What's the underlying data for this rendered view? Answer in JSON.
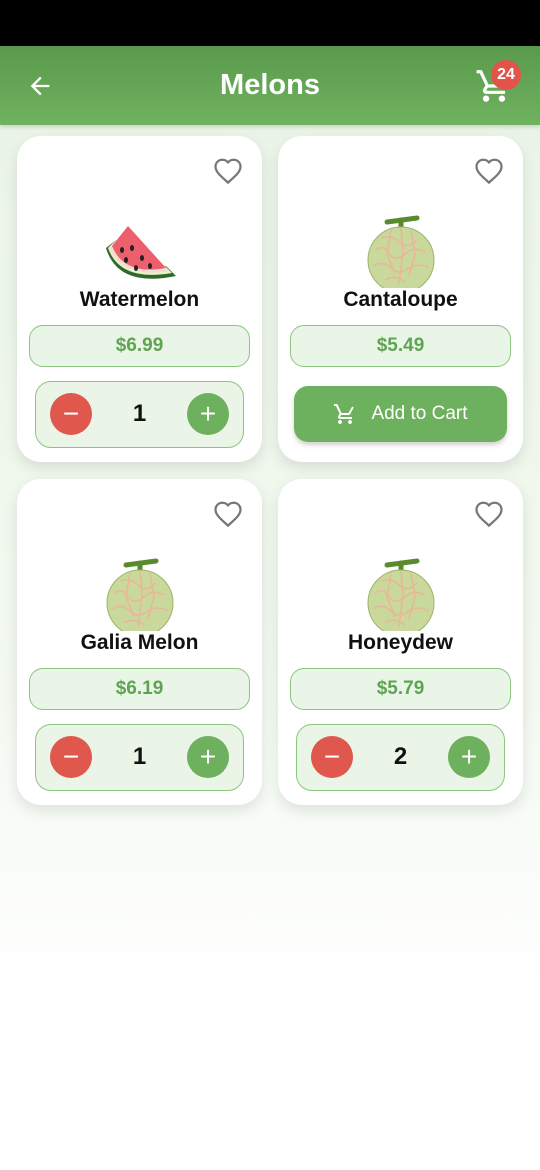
{
  "header": {
    "title": "Melons",
    "cart_count": "24",
    "back_icon": "arrow-left-icon",
    "cart_icon": "cart-icon"
  },
  "colors": {
    "accent": "#6db05d",
    "minus": "#e0574d",
    "badge": "#e2544a",
    "price_text": "#5fa452"
  },
  "products": [
    {
      "name": "Watermelon",
      "price": "$6.99",
      "quantity": "1",
      "image_icon": "watermelon-icon",
      "favorite": false
    },
    {
      "name": "Cantaloupe",
      "price": "$5.49",
      "add_to_cart_label": "Add to Cart",
      "image_icon": "melon-icon",
      "favorite": false
    },
    {
      "name": "Galia Melon",
      "price": "$6.19",
      "quantity": "1",
      "image_icon": "melon-icon",
      "favorite": false
    },
    {
      "name": "Honeydew",
      "price": "$5.79",
      "quantity": "2",
      "image_icon": "melon-icon",
      "favorite": false
    }
  ],
  "controls": {
    "minus_symbol": "−",
    "plus_symbol": "+"
  }
}
